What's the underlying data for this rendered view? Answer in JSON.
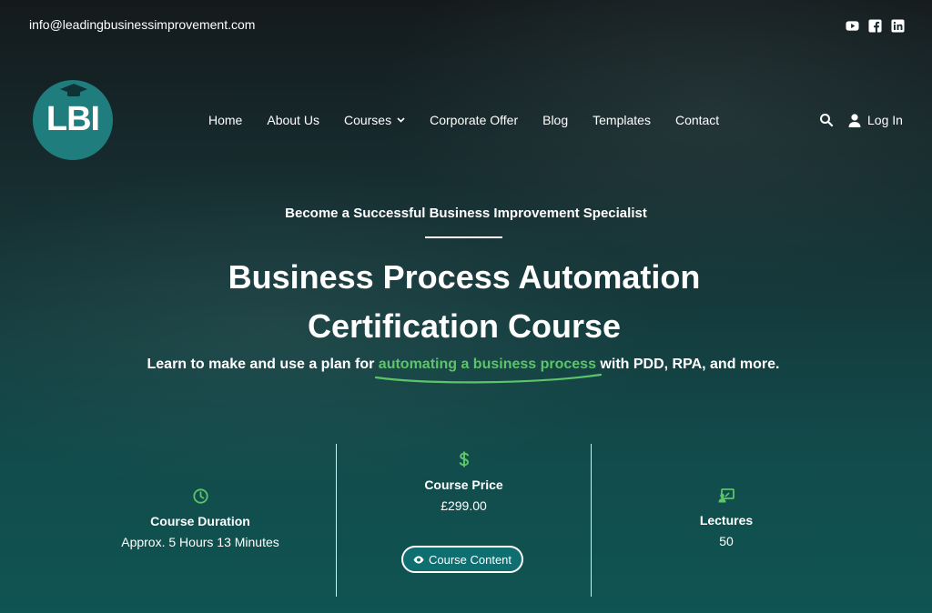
{
  "topbar": {
    "email": "info@leadingbusinessimprovement.com",
    "socials": [
      {
        "name": "youtube-icon"
      },
      {
        "name": "facebook-icon"
      },
      {
        "name": "linkedin-icon"
      }
    ]
  },
  "logo": {
    "text": "LBI"
  },
  "nav": {
    "items": [
      {
        "label": "Home"
      },
      {
        "label": "About Us"
      },
      {
        "label": "Courses"
      },
      {
        "label": "Corporate Offer"
      },
      {
        "label": "Blog"
      },
      {
        "label": "Templates"
      },
      {
        "label": "Contact"
      }
    ],
    "login_label": "Log In"
  },
  "hero": {
    "eyebrow": "Become a Successful Business Improvement Specialist",
    "title_line1": "Business Process Automation",
    "title_line2": "Certification Course",
    "subtitle_before": "Learn to make and use a plan for ",
    "subtitle_highlight": "automating a business process",
    "subtitle_after": " with PDD, RPA, and more."
  },
  "stats": {
    "duration": {
      "label": "Course Duration",
      "value": "Approx. 5 Hours 13 Minutes",
      "icon": "clock-icon"
    },
    "price": {
      "label": "Course Price",
      "value": "£299.00",
      "icon": "dollar-icon"
    },
    "lectures": {
      "label": "Lectures",
      "value": "50",
      "icon": "lecture-icon"
    },
    "button_label": "Course Content"
  },
  "colors": {
    "accent_green": "#5cc46a",
    "logo_teal": "#1f7d7d",
    "button_teal": "#0f6e70"
  }
}
